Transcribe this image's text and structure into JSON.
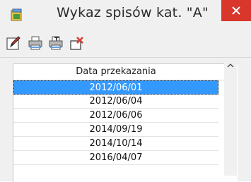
{
  "window": {
    "title": "Wykaz spisów kat. \"A\""
  },
  "toolbar": {
    "buttons": [
      "edit-icon",
      "print-icon",
      "print-text-icon",
      "exit-icon"
    ]
  },
  "list": {
    "column_header": "Data przekazania",
    "rows": [
      "2012/06/01",
      "2012/06/04",
      "2012/06/06",
      "2014/09/19",
      "2014/10/14",
      "2016/04/07"
    ],
    "selected_index": 0
  },
  "colors": {
    "selection": "#3399ff",
    "close_button": "#d9372c"
  }
}
